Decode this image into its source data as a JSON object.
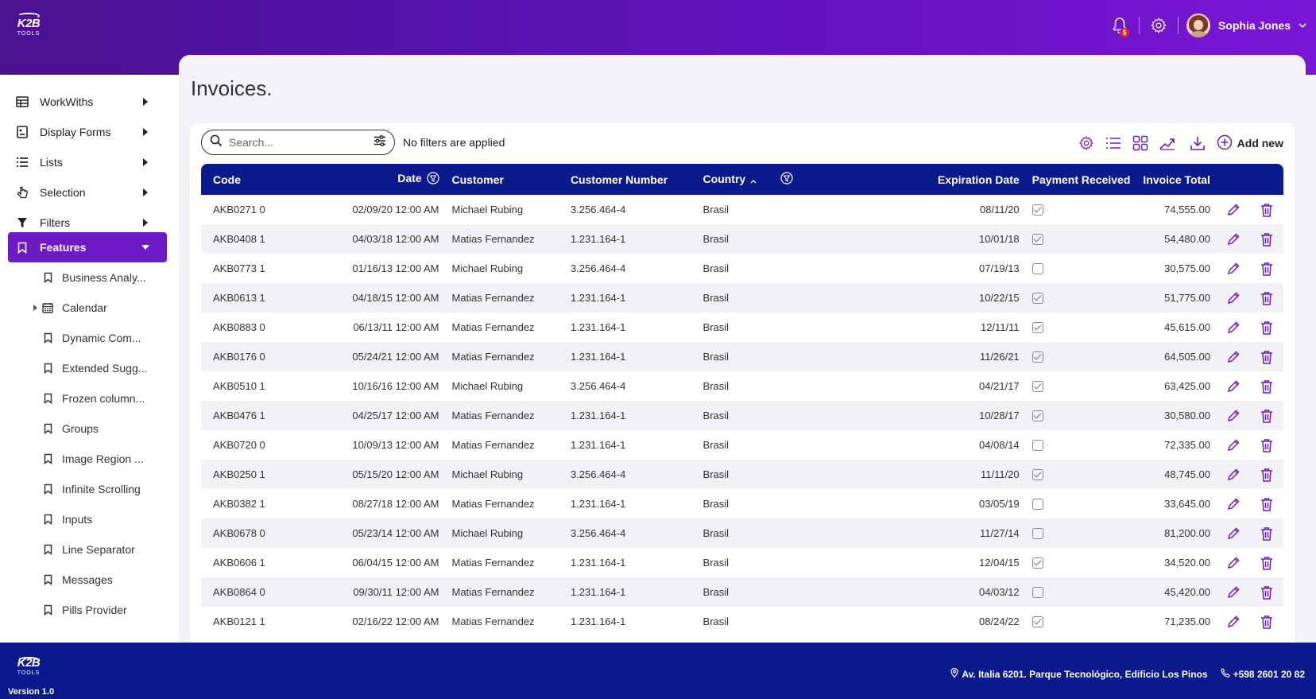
{
  "app": {
    "logo_text": "K2B",
    "logo_subtext": "TOOLS",
    "notifications_count": "5",
    "user_name": "Sophia Jones"
  },
  "sidebar": {
    "items": [
      {
        "label": "WorkWiths",
        "icon": "table-icon"
      },
      {
        "label": "Display Forms",
        "icon": "form-icon"
      },
      {
        "label": "Lists",
        "icon": "list-icon"
      },
      {
        "label": "Selection",
        "icon": "pointer-icon"
      },
      {
        "label": "Filters",
        "icon": "filter-icon"
      },
      {
        "label": "Features",
        "icon": "bookmark-icon"
      }
    ],
    "sub_items": [
      {
        "label": "Business Analy...",
        "icon": "bookmark-icon"
      },
      {
        "label": "Calendar",
        "icon": "calendar-icon"
      },
      {
        "label": "Dynamic Com...",
        "icon": "bookmark-icon"
      },
      {
        "label": "Extended Sugg...",
        "icon": "bookmark-icon"
      },
      {
        "label": "Frozen column...",
        "icon": "bookmark-icon"
      },
      {
        "label": "Groups",
        "icon": "bookmark-icon"
      },
      {
        "label": "Image Region ...",
        "icon": "bookmark-icon"
      },
      {
        "label": "Infinite Scrolling",
        "icon": "bookmark-icon"
      },
      {
        "label": "Inputs",
        "icon": "bookmark-icon"
      },
      {
        "label": "Line Separator",
        "icon": "bookmark-icon"
      },
      {
        "label": "Messages",
        "icon": "bookmark-icon"
      },
      {
        "label": "Pills Provider",
        "icon": "bookmark-icon"
      }
    ]
  },
  "page": {
    "title": "Invoices.",
    "search_placeholder": "Search...",
    "filters_status": "No filters are applied",
    "add_new_label": "Add new"
  },
  "grid": {
    "columns": [
      "Code",
      "Date",
      "Customer",
      "Customer Number",
      "Country",
      "Expiration Date",
      "Payment Received",
      "Invoice Total"
    ],
    "rows": [
      {
        "code": "AKB0271 0",
        "date": "02/09/20 12:00 AM",
        "customer": "Michael Rubing",
        "number": "3.256.464-4",
        "country": "Brasil",
        "exp": "08/11/20",
        "paid": true,
        "total": "74,555.00"
      },
      {
        "code": "AKB0408 1",
        "date": "04/03/18 12:00 AM",
        "customer": "Matias Fernandez",
        "number": "1.231.164-1",
        "country": "Brasil",
        "exp": "10/01/18",
        "paid": true,
        "total": "54,480.00"
      },
      {
        "code": "AKB0773 1",
        "date": "01/16/13 12:00 AM",
        "customer": "Michael Rubing",
        "number": "3.256.464-4",
        "country": "Brasil",
        "exp": "07/19/13",
        "paid": false,
        "total": "30,575.00"
      },
      {
        "code": "AKB0613 1",
        "date": "04/18/15 12:00 AM",
        "customer": "Matias Fernandez",
        "number": "1.231.164-1",
        "country": "Brasil",
        "exp": "10/22/15",
        "paid": true,
        "total": "51,775.00"
      },
      {
        "code": "AKB0883 0",
        "date": "06/13/11 12:00 AM",
        "customer": "Matias Fernandez",
        "number": "1.231.164-1",
        "country": "Brasil",
        "exp": "12/11/11",
        "paid": true,
        "total": "45,615.00"
      },
      {
        "code": "AKB0176 0",
        "date": "05/24/21 12:00 AM",
        "customer": "Matias Fernandez",
        "number": "1.231.164-1",
        "country": "Brasil",
        "exp": "11/26/21",
        "paid": true,
        "total": "64,505.00"
      },
      {
        "code": "AKB0510 1",
        "date": "10/16/16 12:00 AM",
        "customer": "Michael Rubing",
        "number": "3.256.464-4",
        "country": "Brasil",
        "exp": "04/21/17",
        "paid": true,
        "total": "63,425.00"
      },
      {
        "code": "AKB0476 1",
        "date": "04/25/17 12:00 AM",
        "customer": "Matias Fernandez",
        "number": "1.231.164-1",
        "country": "Brasil",
        "exp": "10/28/17",
        "paid": true,
        "total": "30,580.00"
      },
      {
        "code": "AKB0720 0",
        "date": "10/09/13 12:00 AM",
        "customer": "Matias Fernandez",
        "number": "1.231.164-1",
        "country": "Brasil",
        "exp": "04/08/14",
        "paid": false,
        "total": "72,335.00"
      },
      {
        "code": "AKB0250 1",
        "date": "05/15/20 12:00 AM",
        "customer": "Michael Rubing",
        "number": "3.256.464-4",
        "country": "Brasil",
        "exp": "11/11/20",
        "paid": true,
        "total": "48,745.00"
      },
      {
        "code": "AKB0382 1",
        "date": "08/27/18 12:00 AM",
        "customer": "Matias Fernandez",
        "number": "1.231.164-1",
        "country": "Brasil",
        "exp": "03/05/19",
        "paid": false,
        "total": "33,645.00"
      },
      {
        "code": "AKB0678 0",
        "date": "05/23/14 12:00 AM",
        "customer": "Michael Rubing",
        "number": "3.256.464-4",
        "country": "Brasil",
        "exp": "11/27/14",
        "paid": false,
        "total": "81,200.00"
      },
      {
        "code": "AKB0606 1",
        "date": "06/04/15 12:00 AM",
        "customer": "Matias Fernandez",
        "number": "1.231.164-1",
        "country": "Brasil",
        "exp": "12/04/15",
        "paid": true,
        "total": "34,520.00"
      },
      {
        "code": "AKB0864 0",
        "date": "09/30/11 12:00 AM",
        "customer": "Matias Fernandez",
        "number": "1.231.164-1",
        "country": "Brasil",
        "exp": "04/03/12",
        "paid": false,
        "total": "45,420.00"
      },
      {
        "code": "AKB0121 1",
        "date": "02/16/22 12:00 AM",
        "customer": "Matias Fernandez",
        "number": "1.231.164-1",
        "country": "Brasil",
        "exp": "08/24/22",
        "paid": true,
        "total": "71,235.00"
      }
    ]
  },
  "footer": {
    "address": "Av. Italia 6201. Parque Tecnológico, Edificio Los Pinos",
    "phone": "+598 2601 20 82",
    "version": "Version 1.0"
  },
  "colors": {
    "header_gradient_start": "#4b1291",
    "header_gradient_end": "#7a16d6",
    "accent": "#6c1bc6",
    "grid_header": "#0b1a8c",
    "footer": "#0b1a8c"
  }
}
